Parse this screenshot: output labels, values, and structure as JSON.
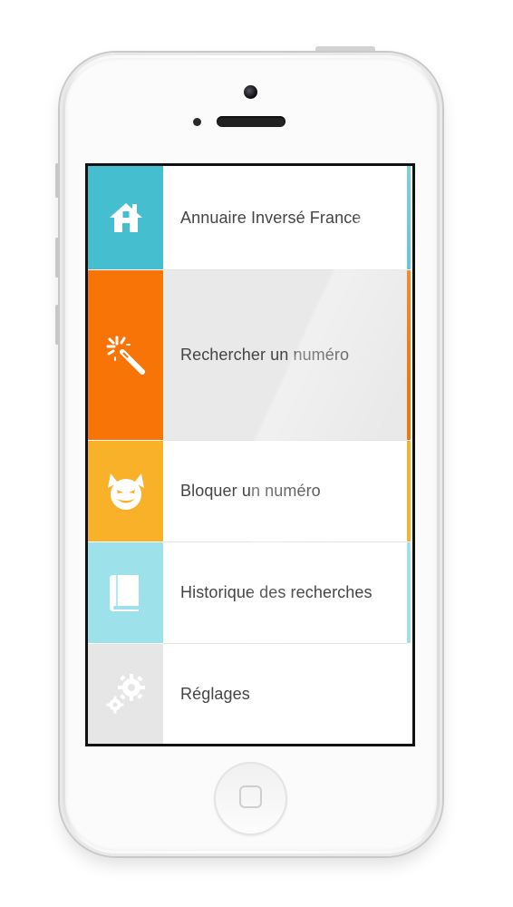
{
  "menu": {
    "items": [
      {
        "label": "Annuaire Inversé France",
        "icon": "home-icon",
        "color": "#45BFD0",
        "selected": false
      },
      {
        "label": "Rechercher un numéro",
        "icon": "magic-wand-icon",
        "color": "#F97406",
        "selected": true
      },
      {
        "label": "Bloquer un numéro",
        "icon": "devil-icon",
        "color": "#F9B12A",
        "selected": false
      },
      {
        "label": "Historique des recherches",
        "icon": "book-icon",
        "color": "#9DE1EA",
        "selected": false
      },
      {
        "label": "Réglages",
        "icon": "gears-icon",
        "color": "#E6E6E6",
        "selected": false
      }
    ]
  },
  "colors": {
    "selected_row_bg": "#E9E9E9",
    "label_text": "#444444",
    "icon_fill": "#FFFFFF"
  }
}
